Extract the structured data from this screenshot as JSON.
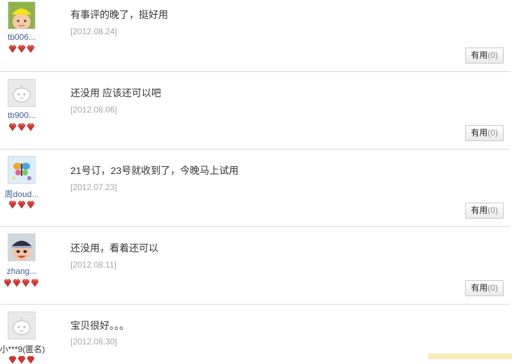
{
  "reviews": [
    {
      "username": "tb006...",
      "avatar_icon": "baby-yellow-hat-avatar",
      "gem_count": 3,
      "content": "有事评的晚了，挺好用",
      "date": "[2012.08.24]",
      "useful_label": "有用",
      "useful_count": "(0)"
    },
    {
      "username": "tb900...",
      "avatar_icon": "default-face-avatar",
      "gem_count": 3,
      "content": "还没用 应该还可以吧",
      "date": "[2012.08.06]",
      "useful_label": "有用",
      "useful_count": "(0)"
    },
    {
      "username": "周doud...",
      "avatar_icon": "butterfly-avatar",
      "gem_count": 3,
      "content": "21号订，23号就收到了，今晚马上试用",
      "date": "[2012.07.23]",
      "useful_label": "有用",
      "useful_count": "(0)"
    },
    {
      "username": "zhang...",
      "avatar_icon": "baby-cap-avatar",
      "gem_count": 4,
      "content": "还没用，看着还可以",
      "date": "[2012.08.11]",
      "useful_label": "有用",
      "useful_count": "(0)"
    },
    {
      "username": "小***9(匿名)",
      "avatar_icon": "default-face-avatar",
      "gem_count": 3,
      "content": "宝贝很好。。。",
      "date": "[2012.08.30]",
      "useful_label": "",
      "useful_count": ""
    }
  ],
  "colors": {
    "username": "#3a5f9e",
    "date": "#a5a5a5",
    "gem": "#d9342b",
    "divider": "#d9d9d9"
  }
}
